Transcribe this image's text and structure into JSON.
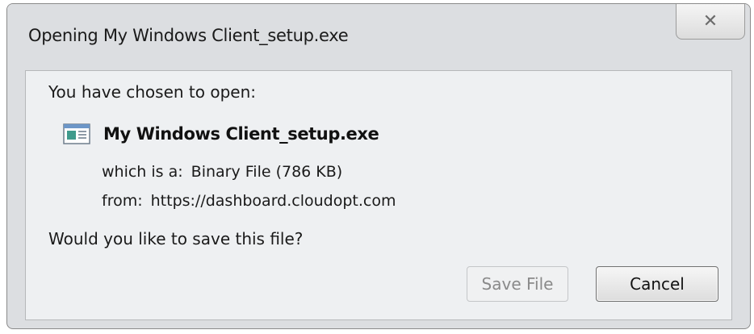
{
  "dialog": {
    "title": "Opening My Windows Client_setup.exe",
    "close_icon": "close-icon",
    "prompt": "You have chosen to open:",
    "file": {
      "icon": "application-window-icon",
      "name": "My Windows Client_setup.exe",
      "type_label": "which is a:",
      "type_value": "Binary File (786 KB)",
      "from_label": "from:",
      "from_value": "https://dashboard.cloudopt.com"
    },
    "question": "Would you like to save this file?",
    "buttons": {
      "save": "Save File",
      "cancel": "Cancel"
    }
  }
}
